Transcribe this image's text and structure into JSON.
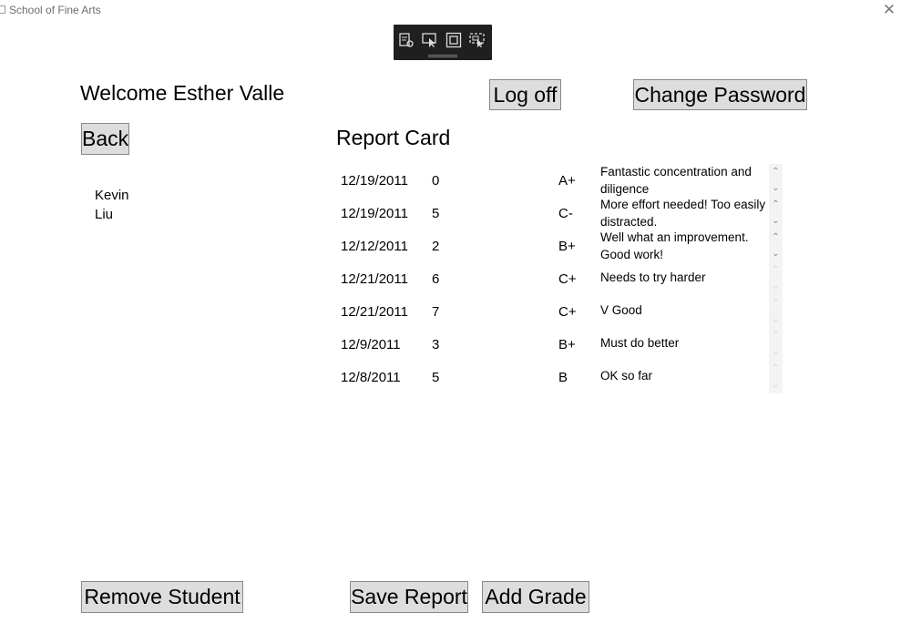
{
  "window": {
    "title": "School of Fine Arts",
    "close_glyph": "✕"
  },
  "header": {
    "welcome": "Welcome Esther Valle",
    "logoff_label": "Log off",
    "change_password_label": "Change Password",
    "back_label": "Back"
  },
  "report": {
    "title": "Report Card",
    "student_lines": [
      "Kevin",
      "Liu"
    ],
    "rows": [
      {
        "date": "12/19/2011",
        "score": "0",
        "grade": "A+",
        "comment": "Fantastic concentration and diligence"
      },
      {
        "date": "12/19/2011",
        "score": "5",
        "grade": "C-",
        "comment": "More effort needed! Too easily distracted."
      },
      {
        "date": "12/12/2011",
        "score": "2",
        "grade": "B+",
        "comment": "Well what an improvement. Good work!"
      },
      {
        "date": "12/21/2011",
        "score": "6",
        "grade": "C+",
        "comment": "Needs to try harder"
      },
      {
        "date": "12/21/2011",
        "score": "7",
        "grade": "C+",
        "comment": "V Good"
      },
      {
        "date": "12/9/2011",
        "score": "3",
        "grade": "B+",
        "comment": "Must do better"
      },
      {
        "date": "12/8/2011",
        "score": "5",
        "grade": "B",
        "comment": "OK so far"
      }
    ]
  },
  "footer": {
    "remove_student_label": "Remove Student",
    "save_report_label": "Save Report",
    "add_grade_label": "Add Grade"
  },
  "debug_toolbar": {
    "tools": [
      "live-visual-tree-icon",
      "select-element-icon",
      "display-layout-adorners-icon",
      "track-focused-element-icon"
    ]
  }
}
